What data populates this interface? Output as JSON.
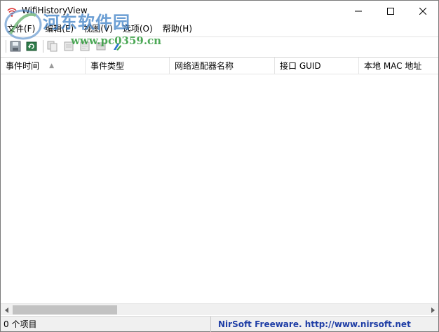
{
  "window": {
    "title": "WifiHistoryView",
    "controls": {
      "minimize": "minimize",
      "maximize": "maximize",
      "close": "close"
    }
  },
  "watermark": {
    "main": "河东软件园",
    "url": "www.pc0359.cn"
  },
  "menu": [
    {
      "label": "文件(F)"
    },
    {
      "label": "编辑(E)"
    },
    {
      "label": "视图(V)"
    },
    {
      "label": "选项(O)"
    },
    {
      "label": "帮助(H)"
    }
  ],
  "toolbar": {
    "icons": [
      "save-icon",
      "refresh-icon",
      "copy-icon",
      "properties-icon",
      "html-report-icon",
      "options-icon",
      "exit-icon"
    ]
  },
  "list": {
    "columns": [
      {
        "label": "事件时间",
        "sorted": true
      },
      {
        "label": "事件类型"
      },
      {
        "label": "网络适配器名称"
      },
      {
        "label": "接口 GUID"
      },
      {
        "label": "本地 MAC 地址"
      }
    ],
    "rows": []
  },
  "status": {
    "count": "0 个项目",
    "credit": "NirSoft Freeware.  http://www.nirsoft.net"
  },
  "colors": {
    "credit": "#1f3ea6",
    "watermark_blue": "#3c7fc6",
    "watermark_green": "#2f9a3a"
  }
}
